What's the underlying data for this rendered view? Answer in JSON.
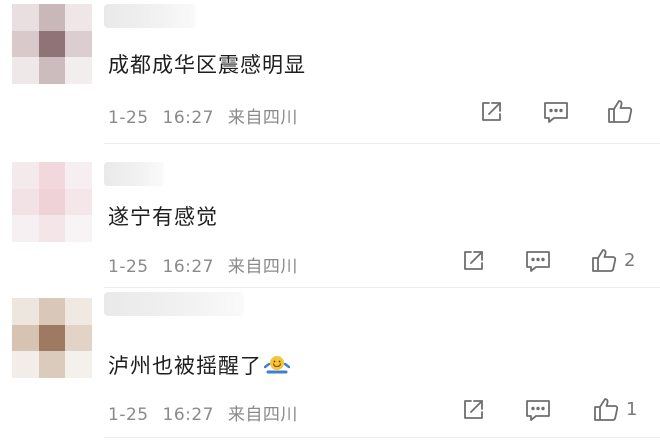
{
  "comments": [
    {
      "text": "成都成华区震感明显",
      "date": "1-25",
      "time": "16:27",
      "location": "来自四川",
      "like_count": ""
    },
    {
      "text": "遂宁有感觉",
      "date": "1-25",
      "time": "16:27",
      "location": "来自四川",
      "like_count": "2"
    },
    {
      "text": "泸州也被摇醒了",
      "date": "1-25",
      "time": "16:27",
      "location": "来自四川",
      "like_count": "1"
    }
  ],
  "icons": {
    "share": "share-icon",
    "comment": "comment-icon",
    "like": "thumbs-up-icon",
    "emoji": "shrug-emoji-icon"
  },
  "colors": {
    "meta_text": "#8a8a8a",
    "icon_stroke": "#6f6f6f",
    "divider": "#ececec"
  }
}
